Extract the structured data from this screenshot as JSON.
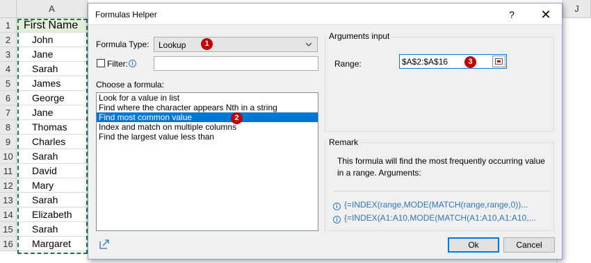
{
  "sheet": {
    "columns": [
      "A",
      "J"
    ],
    "row_numbers": [
      "1",
      "2",
      "3",
      "4",
      "5",
      "6",
      "7",
      "8",
      "9",
      "10",
      "11",
      "12",
      "13",
      "14",
      "15",
      "16"
    ],
    "cells": [
      "First Name",
      "John",
      "Jane",
      "Sarah",
      "James",
      "George",
      "Jane",
      "Thomas",
      "Charles",
      "Sarah",
      "David",
      "Mary",
      "Sarah",
      "Elizabeth",
      "Sarah",
      "Margaret"
    ]
  },
  "dialog": {
    "title": "Formulas Helper",
    "help_symbol": "?",
    "close_symbol": "✕",
    "formula_type_label": "Formula Type:",
    "formula_type_value": "Lookup",
    "filter_label": "Filter:",
    "filter_value": "",
    "choose_label": "Choose a formula:",
    "formulas": [
      "Look for a value in list",
      "Find where the character appears Nth in a string",
      "Find most common value",
      "Index and match on multiple columns",
      "Find the largest value less than"
    ],
    "selected_index": 2,
    "arguments_title": "Arguments input",
    "range_label": "Range:",
    "range_value": "$A$2:$A$16",
    "remark_title": "Remark",
    "remark_text": "This formula will find the most frequently occurring value in a range. Arguments:",
    "examples": [
      "{=INDEX(range,MODE(MATCH(range,range,0))...",
      "{=INDEX(A1:A10,MODE(MATCH(A1:A10,A1:A10,..."
    ],
    "ok_label": "Ok",
    "cancel_label": "Cancel",
    "badges": [
      "1",
      "2",
      "3"
    ]
  },
  "colors": {
    "accent": "#0078d7",
    "badge": "#c00000",
    "link": "#2e75b6",
    "excel_green": "#217346"
  },
  "icons": [
    "chevron-down-icon",
    "info-icon",
    "range-select-icon",
    "expand-icon",
    "help-icon",
    "close-icon"
  ]
}
